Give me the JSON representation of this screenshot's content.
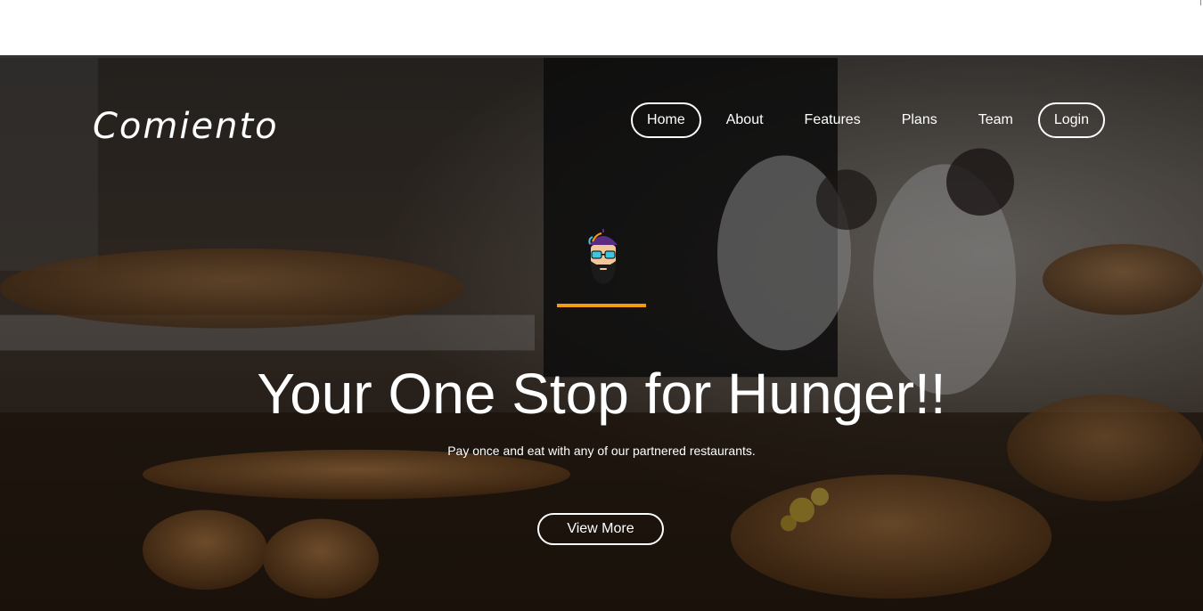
{
  "brand": {
    "name": "Comiento"
  },
  "nav": {
    "items": [
      {
        "label": "Home",
        "active": true
      },
      {
        "label": "About",
        "active": false
      },
      {
        "label": "Features",
        "active": false
      },
      {
        "label": "Plans",
        "active": false
      },
      {
        "label": "Team",
        "active": false
      },
      {
        "label": "Login",
        "active": false
      }
    ]
  },
  "hero": {
    "avatar_icon": "bearded-man-with-sunglasses-icon",
    "title": "Your One Stop for Hunger!!",
    "subtitle": "Pay once and eat with any of our partnered restaurants.",
    "cta_label": "View More"
  },
  "colors": {
    "accent": "#f39c12",
    "text": "#ffffff",
    "overlay": "#000000"
  }
}
